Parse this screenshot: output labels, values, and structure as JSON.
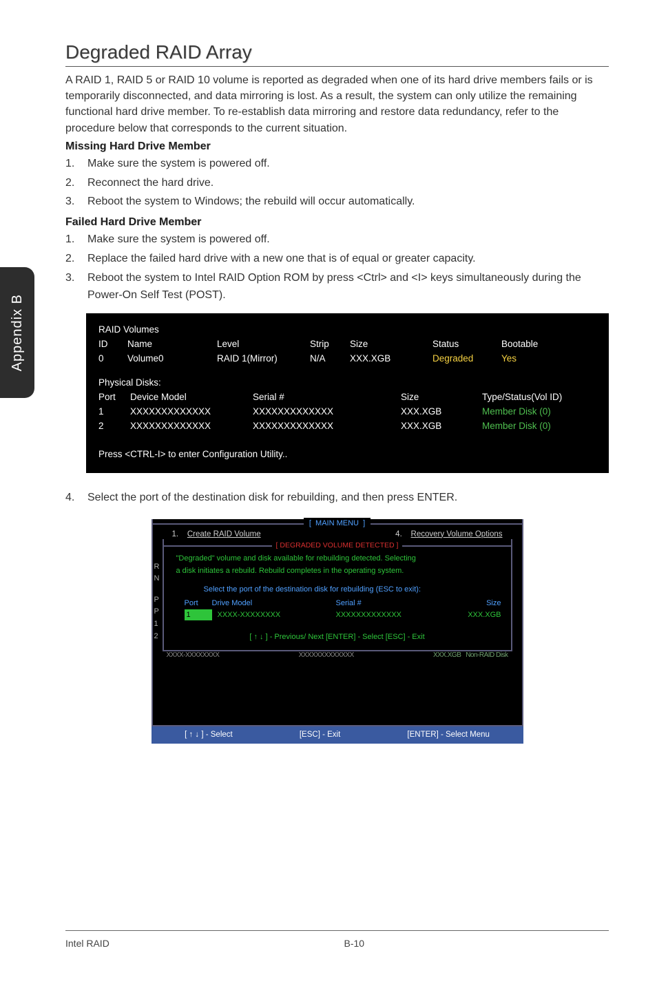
{
  "sidebarTab": "Appendix B",
  "title": "Degraded RAID Array",
  "intro": "A RAID 1, RAID 5 or RAID 10 volume is reported as degraded when one of its hard drive members fails or is temporarily disconnected, and data mirroring is lost. As a result, the system can only utilize the remaining functional hard drive member. To re-establish data mirroring and restore data redundancy, refer to the procedure below that corresponds to the current situation.",
  "missing": {
    "heading": "Missing Hard Drive Member",
    "steps": [
      "Make sure the system is powered off.",
      "Reconnect the hard drive.",
      "Reboot the system to Windows; the rebuild will occur automatically."
    ]
  },
  "failed": {
    "heading": "Failed Hard Drive Member",
    "steps": [
      "Make sure the system is powered off.",
      "Replace the failed hard drive with a new one that is of equal or greater capacity.",
      "Reboot the system to Intel RAID Option ROM by press <Ctrl> and <I> keys simultaneously during the Power-On Self Test (POST)."
    ]
  },
  "rom": {
    "raidVolumesLabel": "RAID Volumes",
    "headers": {
      "id": "ID",
      "name": "Name",
      "level": "Level",
      "strip": "Strip",
      "size": "Size",
      "status": "Status",
      "bootable": "Bootable"
    },
    "volumes": [
      {
        "id": "0",
        "name": "Volume0",
        "level": "RAID 1(Mirror)",
        "strip": "N/A",
        "size": "XXX.XGB",
        "status": "Degraded",
        "bootable": "Yes"
      }
    ],
    "physicalDisksLabel": "Physical Disks:",
    "pdHeaders": {
      "port": "Port",
      "deviceModel": "Device Model",
      "serial": "Serial #",
      "size": "Size",
      "typeStatus": "Type/Status(Vol ID)"
    },
    "disks": [
      {
        "port": "1",
        "deviceModel": "XXXXXXXXXXXXX",
        "serial": "XXXXXXXXXXXXX",
        "size": "XXX.XGB",
        "typeStatus": "Member  Disk (0)"
      },
      {
        "port": "2",
        "deviceModel": "XXXXXXXXXXXXX",
        "serial": "XXXXXXXXXXXXX",
        "size": "XXX.XGB",
        "typeStatus": "Member  Disk (0)"
      }
    ],
    "pressLabel": "Press  <CTRL-I>  to enter Configuration Utility.."
  },
  "step4": "Select the port of the destination disk for rebuilding, and then press ENTER.",
  "menu": {
    "mainMenu": "MAIN  MENU",
    "opt1num": "1.",
    "opt1": "Create  RAID  Volume",
    "opt4num": "4.",
    "opt4": "Recovery  Volume  Options",
    "detected": "[  DEGRADED VOLUME DETECTED  ]",
    "line1": "\"Degraded\" volume and disk available for rebuilding detected. Selecting",
    "line2": "a disk initiates a rebuild. Rebuild completes in the  operating system.",
    "selectPort": "Select the port of the destination disk for rebuilding (ESC to exit):",
    "cols": {
      "port": "Port",
      "model": "Drive  Model",
      "serial": "Serial  #",
      "size": "Size"
    },
    "row": {
      "port": "1",
      "model": "XXXX-XXXXXXXX",
      "serial": "XXXXXXXXXXXXX",
      "size": "XXX.XGB"
    },
    "hints": "[ ↑ ↓ ] - Previous/ Next       [ENTER] - Select      [ESC] - Exit",
    "footer": {
      "a": "[ ↑ ↓ ] - Select",
      "b": "[ESC] - Exit",
      "c": "[ENTER] - Select Menu"
    }
  },
  "pageFooter": {
    "left": "Intel RAID",
    "right": "B-10"
  }
}
